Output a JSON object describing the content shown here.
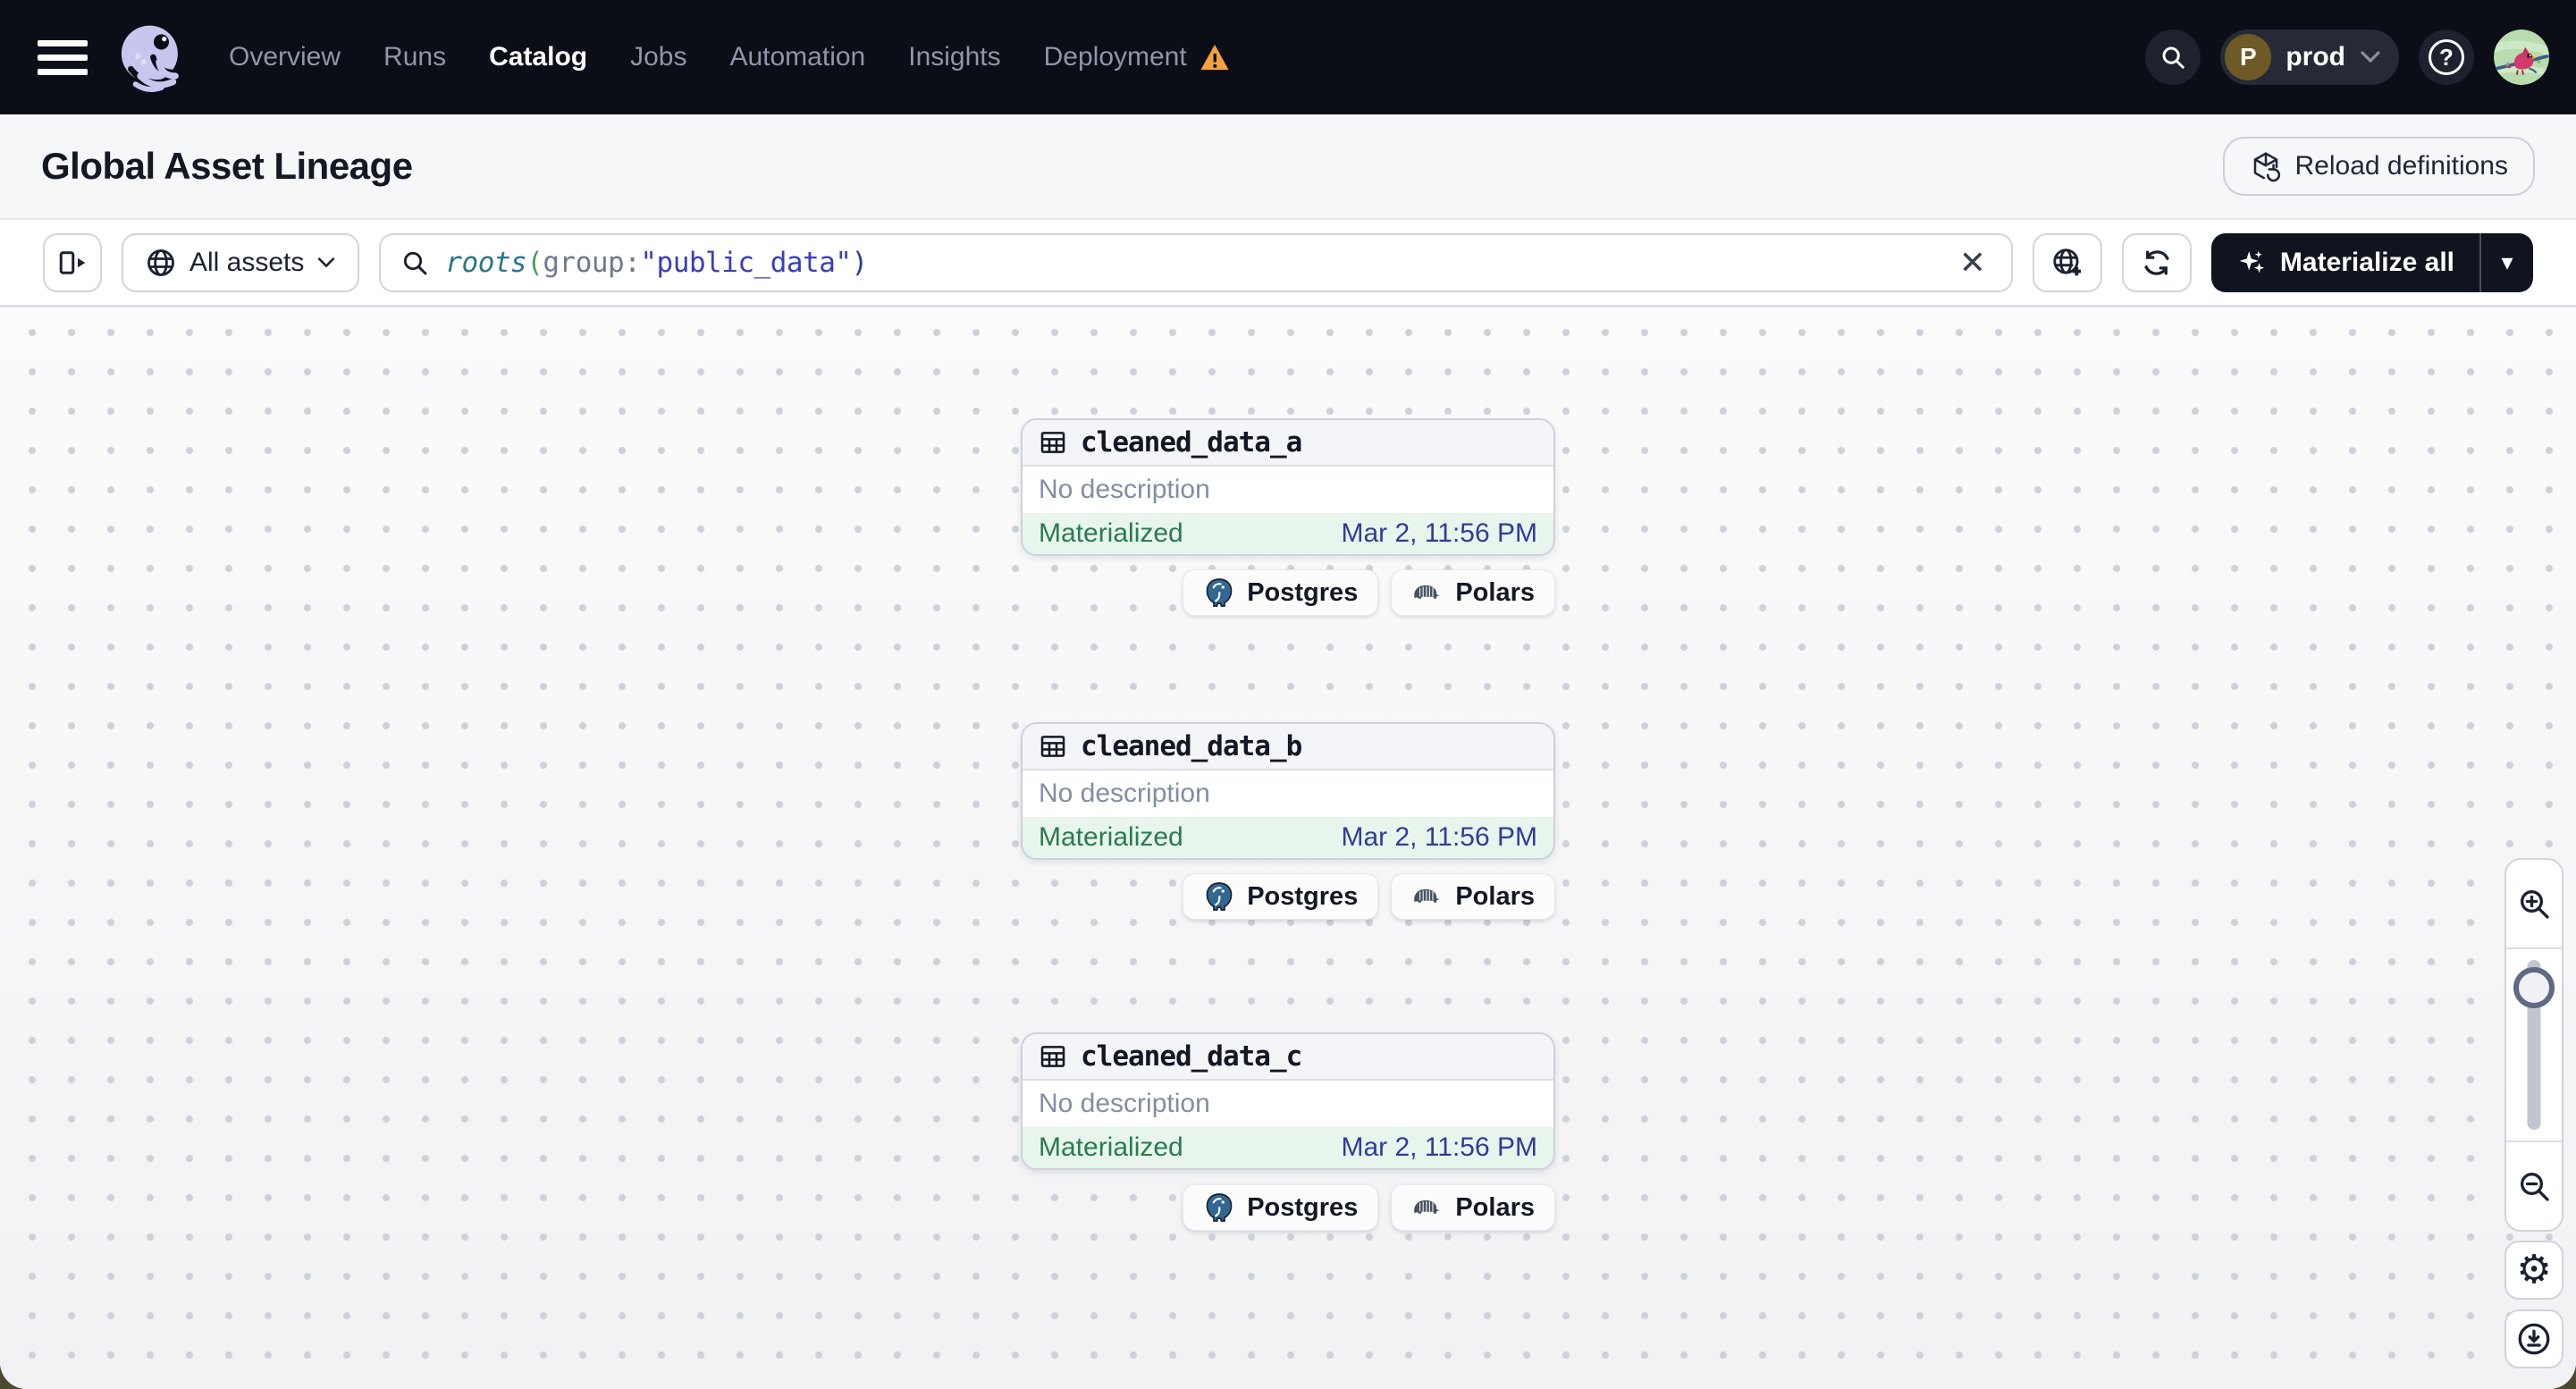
{
  "topnav": {
    "nav_items": [
      {
        "label": "Overview",
        "active": false
      },
      {
        "label": "Runs",
        "active": false
      },
      {
        "label": "Catalog",
        "active": true
      },
      {
        "label": "Jobs",
        "active": false
      },
      {
        "label": "Automation",
        "active": false
      },
      {
        "label": "Insights",
        "active": false
      },
      {
        "label": "Deployment",
        "active": false,
        "warning": true
      }
    ],
    "environment": {
      "initial": "P",
      "name": "prod"
    }
  },
  "page_header": {
    "title": "Global Asset Lineage",
    "reload_button": "Reload definitions"
  },
  "toolbar": {
    "filter_dropdown": "All assets",
    "query": {
      "fn": "roots",
      "open": "(",
      "field": "group",
      "colon": ":",
      "value": "\"public_data\"",
      "close": ")"
    },
    "materialize_button": "Materialize all"
  },
  "graph": {
    "nodes": [
      {
        "name": "cleaned_data_a",
        "description": "No description",
        "status": "Materialized",
        "timestamp": "Mar 2, 11:56 PM",
        "tags": [
          {
            "label": "Postgres"
          },
          {
            "label": "Polars"
          }
        ]
      },
      {
        "name": "cleaned_data_b",
        "description": "No description",
        "status": "Materialized",
        "timestamp": "Mar 2, 11:56 PM",
        "tags": [
          {
            "label": "Postgres"
          },
          {
            "label": "Polars"
          }
        ]
      },
      {
        "name": "cleaned_data_c",
        "description": "No description",
        "status": "Materialized",
        "timestamp": "Mar 2, 11:56 PM",
        "tags": [
          {
            "label": "Postgres"
          },
          {
            "label": "Polars"
          }
        ]
      }
    ]
  },
  "icons": {
    "clear": "✕",
    "caret_down": "▾",
    "help": "?",
    "gear": "⚙"
  },
  "colors": {
    "header_bg": "#0b0d17",
    "warning_orange": "#f2a33c",
    "materialized_green": "#2a7b4f",
    "materialized_bg": "#e7f5ec",
    "timestamp_blue": "#323c99",
    "query_fn_teal": "#2d7586",
    "query_paren_green": "#4c9b63",
    "query_field_gray": "#707a8c",
    "query_value_indigo": "#3a3ebc",
    "postgres_blue": "#336791"
  }
}
